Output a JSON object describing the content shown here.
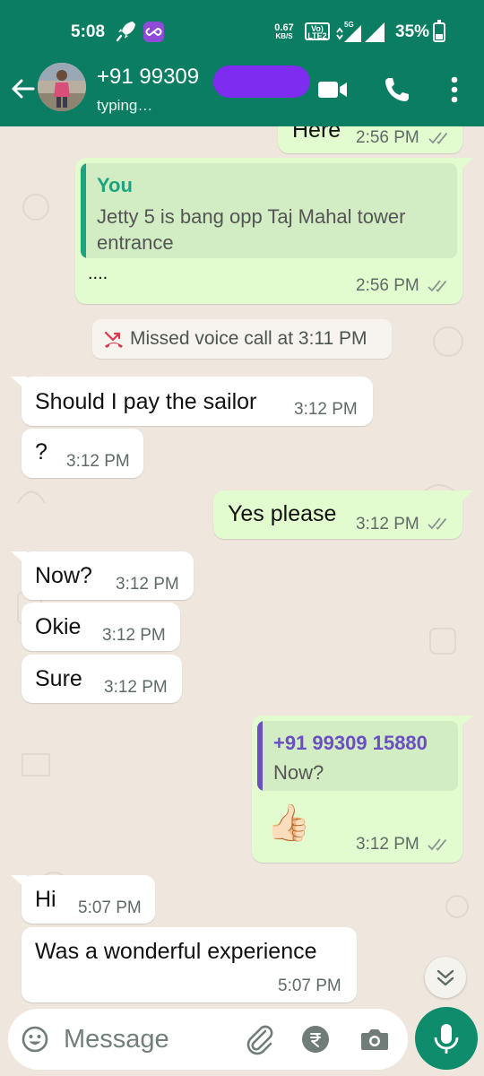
{
  "status_bar": {
    "time": "5:08",
    "net_speed": "0.67",
    "net_unit": "KB/S",
    "volte": "Vo) LTE2",
    "battery": "35%"
  },
  "header": {
    "contact_name": "+91 99309",
    "status": "typing…"
  },
  "messages": [
    {
      "dir": "out",
      "text": "Here",
      "time": "2:56 PM"
    },
    {
      "dir": "out",
      "quote_author": "You",
      "quote_text": "Jetty 5 is bang opp Taj Mahal tower entrance",
      "text": "....",
      "time": "2:56 PM"
    },
    {
      "dir": "system",
      "text": "Missed voice call at 3:11 PM"
    },
    {
      "dir": "in",
      "text": "Should I pay the sailor",
      "time": "3:12 PM"
    },
    {
      "dir": "in",
      "text": "?",
      "time": "3:12 PM"
    },
    {
      "dir": "out",
      "text": "Yes please",
      "time": "3:12 PM"
    },
    {
      "dir": "in",
      "text": "Now?",
      "time": "3:12 PM"
    },
    {
      "dir": "in",
      "text": "Okie",
      "time": "3:12 PM"
    },
    {
      "dir": "in",
      "text": "Sure",
      "time": "3:12 PM"
    },
    {
      "dir": "out",
      "quote_author": "+91 99309 15880",
      "quote_text": "Now?",
      "emoji": "👍🏻",
      "time": "3:12 PM"
    },
    {
      "dir": "in",
      "text": "Hi",
      "time": "5:07 PM"
    },
    {
      "dir": "in",
      "text": "Was a wonderful experience",
      "time": "5:07 PM"
    }
  ],
  "composer": {
    "placeholder": "Message"
  },
  "colors": {
    "header": "#0b7d62",
    "outgoing": "#e2fccf",
    "incoming": "#ffffff",
    "quote_you": "#1ea380",
    "quote_other": "#6a4ec2",
    "ticks": "#8b9691",
    "missed_call": "#e0364b",
    "mic": "#0e8c6b"
  },
  "icons": [
    "back-arrow-icon",
    "video-call-icon",
    "voice-call-icon",
    "more-options-icon",
    "double-tick-icon",
    "missed-call-icon",
    "scroll-down-icon",
    "emoji-icon",
    "attach-icon",
    "rupee-icon",
    "camera-icon",
    "mic-icon"
  ]
}
